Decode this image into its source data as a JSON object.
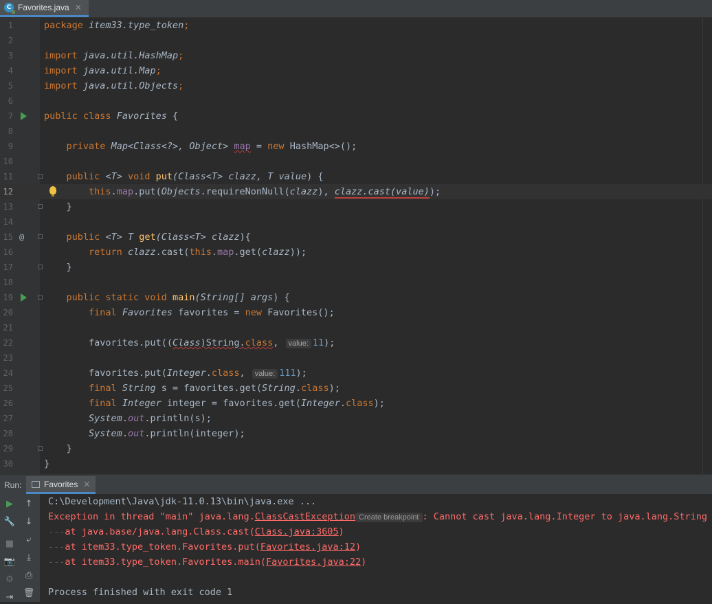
{
  "tab": {
    "label": "Favorites.java",
    "icon": "java-class-icon"
  },
  "editor": {
    "lines": [
      {
        "n": "1"
      },
      {
        "n": "2"
      },
      {
        "n": "3"
      },
      {
        "n": "4"
      },
      {
        "n": "5"
      },
      {
        "n": "6"
      },
      {
        "n": "7"
      },
      {
        "n": "8"
      },
      {
        "n": "9"
      },
      {
        "n": "10"
      },
      {
        "n": "11"
      },
      {
        "n": "12"
      },
      {
        "n": "13"
      },
      {
        "n": "14"
      },
      {
        "n": "15"
      },
      {
        "n": "16"
      },
      {
        "n": "17"
      },
      {
        "n": "18"
      },
      {
        "n": "19"
      },
      {
        "n": "20"
      },
      {
        "n": "21"
      },
      {
        "n": "22"
      },
      {
        "n": "23"
      },
      {
        "n": "24"
      },
      {
        "n": "25"
      },
      {
        "n": "26"
      },
      {
        "n": "27"
      },
      {
        "n": "28"
      },
      {
        "n": "29"
      },
      {
        "n": "30"
      }
    ],
    "code": {
      "l1_kw": "package",
      "l1_pkg": "item33.type_token",
      "l1_end": ";",
      "l3_kw": "import",
      "l3_pkg": "java.util.HashMap",
      "l3_end": ";",
      "l4_kw": "import",
      "l4_pkg": "java.util.Map",
      "l4_end": ";",
      "l5_kw": "import",
      "l5_pkg": "java.util.Objects",
      "l5_end": ";",
      "l7_kw": "public class",
      "l7_cls": "Favorites",
      "l7_end": " {",
      "l9_kw": "private",
      "l9_a": "Map<Class<?>, Object>",
      "l9_b": "map",
      "l9_c": " = ",
      "l9_d": "new",
      "l9_e": " HashMap<>();",
      "l11_kw": "public",
      "l11_a": "<T>",
      "l11_b": "void",
      "l11_c": "put",
      "l11_d": "(Class<T>",
      "l11_e": "clazz",
      "l11_f": ", T",
      "l11_g": "value",
      "l11_h": ") {",
      "l12_kw": "this",
      "l12_a": ".",
      "l12_b": "map",
      "l12_c": ".put(",
      "l12_d": "Objects",
      "l12_e": ".requireNonNull(",
      "l12_f": "clazz",
      "l12_g": "), ",
      "l12_h": "clazz.cast(value)",
      "l12_i": ");",
      "l13": "}",
      "l15_kw": "public",
      "l15_a": "<T>",
      "l15_b": "T",
      "l15_c": "get",
      "l15_d": "(Class<T>",
      "l15_e": "clazz",
      "l15_f": "){",
      "l16_kw": "return",
      "l16_a": "clazz",
      "l16_b": ".cast(",
      "l16_c": "this",
      "l16_d": ".",
      "l16_e": "map",
      "l16_f": ".get(",
      "l16_g": "clazz",
      "l16_h": "));",
      "l17": "}",
      "l19_kw": "public static void",
      "l19_a": "main",
      "l19_b": "(String[]",
      "l19_c": "args",
      "l19_d": ") {",
      "l20_kw": "final",
      "l20_a": "Favorites",
      "l20_b": " favorites = ",
      "l20_c": "new",
      "l20_d": " Favorites();",
      "l22_a": "favorites.put((",
      "l22_b": "Class",
      "l22_c": ")String.",
      "l22_d": "class",
      "l22_e": ",",
      "l22_hint": "value:",
      "l22_num": "11",
      "l22_end": ");",
      "l24_a": "favorites.put(",
      "l24_b": "Integer",
      "l24_c": ".",
      "l24_d": "class",
      "l24_e": ",",
      "l24_hint": "value:",
      "l24_num": "111",
      "l24_end": ");",
      "l25_kw": "final",
      "l25_a": "String",
      "l25_b": " s = favorites.get(",
      "l25_c": "String",
      "l25_d": ".",
      "l25_e": "class",
      "l25_f": ");",
      "l26_kw": "final",
      "l26_a": "Integer",
      "l26_b": " integer = favorites.get(",
      "l26_c": "Integer",
      "l26_d": ".",
      "l26_e": "class",
      "l26_f": ");",
      "l27_a": "System",
      "l27_b": ".",
      "l27_c": "out",
      "l27_d": ".println(s);",
      "l28_a": "System",
      "l28_b": ".",
      "l28_c": "out",
      "l28_d": ".println(integer);",
      "l29": "}",
      "l30": "}"
    },
    "gutter_marker_at": "@"
  },
  "run": {
    "label": "Run:",
    "tab_label": "Favorites",
    "console": {
      "cmd": "C:\\Development\\Java\\jdk-11.0.13\\bin\\java.exe ...",
      "exc_a": "Exception in thread \"main\" java.lang.",
      "exc_link": "ClassCastException",
      "exc_hint": "Create breakpoint",
      "exc_b": ": Cannot cast java.lang.Integer to java.lang.String",
      "st1_a": "at java.base/java.lang.Class.cast(",
      "st1_link": "Class.java:3605",
      "st1_b": ")",
      "st2_a": "at item33.type_token.Favorites.put(",
      "st2_link": "Favorites.java:12",
      "st2_b": ")",
      "st3_a": "at item33.type_token.Favorites.main(",
      "st3_link": "Favorites.java:22",
      "st3_b": ")",
      "finish": "Process finished with exit code 1"
    }
  },
  "colors": {
    "keyword": "#cc7832",
    "error": "#ff6b68",
    "accent": "#4a88c7",
    "run_green": "#499c54"
  }
}
